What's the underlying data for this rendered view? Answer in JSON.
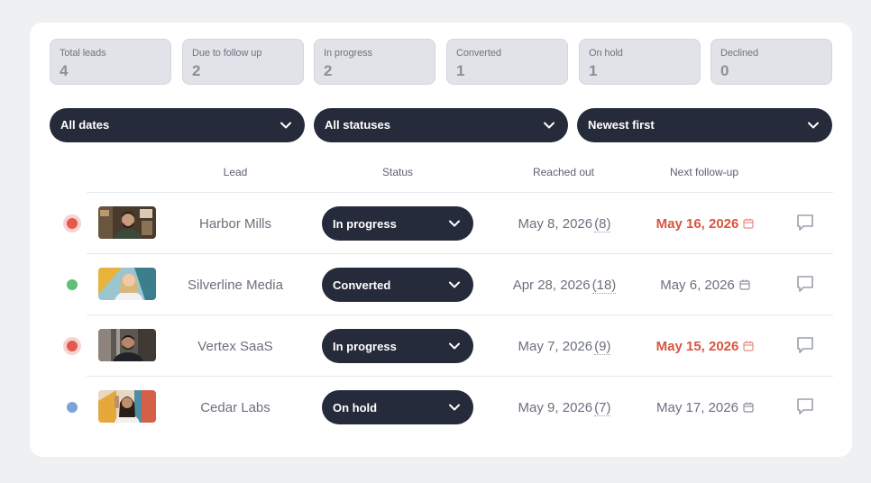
{
  "stats": [
    {
      "label": "Total leads",
      "value": "4"
    },
    {
      "label": "Due to follow up",
      "value": "2"
    },
    {
      "label": "In progress",
      "value": "2"
    },
    {
      "label": "Converted",
      "value": "1"
    },
    {
      "label": "On hold",
      "value": "1"
    },
    {
      "label": "Declined",
      "value": "0"
    }
  ],
  "filters": {
    "dates": "All dates",
    "statuses": "All statuses",
    "sort": "Newest first"
  },
  "columns": {
    "lead": "Lead",
    "status": "Status",
    "reached_out": "Reached out",
    "next_followup": "Next follow-up"
  },
  "colors": {
    "pill_bg": "#262b3b",
    "overdue": "#d9553f",
    "dot_red": "#e35a4c",
    "dot_green": "#5cc079",
    "dot_blue": "#7aa3db"
  },
  "rows": [
    {
      "name": "Harbor Mills",
      "status": "In progress",
      "reached": "May 8, 2026",
      "days": "(8)",
      "followup": "May 16, 2026",
      "overdue": true,
      "indicator": "red"
    },
    {
      "name": "Silverline Media",
      "status": "Converted",
      "reached": "Apr 28, 2026",
      "days": "(18)",
      "followup": "May 6, 2026",
      "overdue": false,
      "indicator": "green"
    },
    {
      "name": "Vertex SaaS",
      "status": "In progress",
      "reached": "May 7, 2026",
      "days": "(9)",
      "followup": "May 15, 2026",
      "overdue": true,
      "indicator": "red"
    },
    {
      "name": "Cedar Labs",
      "status": "On hold",
      "reached": "May 9, 2026",
      "days": "(7)",
      "followup": "May 17, 2026",
      "overdue": false,
      "indicator": "blue"
    }
  ],
  "icons": {
    "chevron": "chevron-down-icon",
    "calendar": "calendar-icon",
    "comment": "comment-icon"
  }
}
